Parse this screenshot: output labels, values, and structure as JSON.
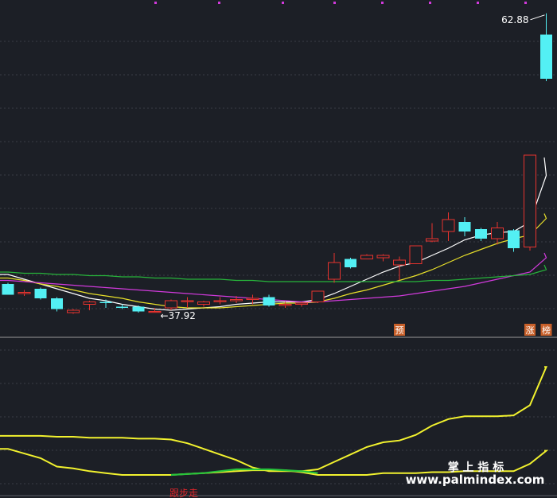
{
  "chart_data": [
    {
      "type": "candlestick",
      "title": "",
      "ylim": [
        36,
        64
      ],
      "candles": [
        {
          "o": 40.2,
          "h": 40.3,
          "l": 39.3,
          "c": 39.3
        },
        {
          "o": 39.4,
          "h": 39.7,
          "l": 39.2,
          "c": 39.5
        },
        {
          "o": 39.8,
          "h": 39.9,
          "l": 38.9,
          "c": 39.0
        },
        {
          "o": 39.0,
          "h": 39.1,
          "l": 37.9,
          "c": 38.1
        },
        {
          "o": 37.8,
          "h": 38.1,
          "l": 37.7,
          "c": 38.0
        },
        {
          "o": 38.5,
          "h": 38.8,
          "l": 38.0,
          "c": 38.7
        },
        {
          "o": 38.7,
          "h": 38.9,
          "l": 38.2,
          "c": 38.6
        },
        {
          "o": 38.3,
          "h": 38.5,
          "l": 38.1,
          "c": 38.2
        },
        {
          "o": 38.3,
          "h": 38.4,
          "l": 37.8,
          "c": 37.9
        },
        {
          "o": 37.9,
          "h": 38.2,
          "l": 37.8,
          "c": 37.9
        },
        {
          "o": 38.2,
          "h": 38.9,
          "l": 38.0,
          "c": 38.8
        },
        {
          "o": 38.8,
          "h": 39.1,
          "l": 38.2,
          "c": 38.8
        },
        {
          "o": 38.5,
          "h": 38.8,
          "l": 38.3,
          "c": 38.7
        },
        {
          "o": 38.8,
          "h": 39.1,
          "l": 38.5,
          "c": 38.8
        },
        {
          "o": 38.8,
          "h": 39.2,
          "l": 38.6,
          "c": 38.9
        },
        {
          "o": 38.9,
          "h": 39.3,
          "l": 38.5,
          "c": 39.0
        },
        {
          "o": 39.1,
          "h": 39.3,
          "l": 38.3,
          "c": 38.4
        },
        {
          "o": 38.4,
          "h": 38.7,
          "l": 38.2,
          "c": 38.5
        },
        {
          "o": 38.5,
          "h": 38.7,
          "l": 38.3,
          "c": 38.6
        },
        {
          "o": 38.7,
          "h": 39.6,
          "l": 38.6,
          "c": 39.6
        },
        {
          "o": 40.6,
          "h": 42.8,
          "l": 40.3,
          "c": 42.0
        },
        {
          "o": 42.3,
          "h": 42.4,
          "l": 41.5,
          "c": 41.6
        },
        {
          "o": 42.3,
          "h": 42.7,
          "l": 42.3,
          "c": 42.6
        },
        {
          "o": 42.4,
          "h": 42.7,
          "l": 42.1,
          "c": 42.6
        },
        {
          "o": 41.8,
          "h": 42.5,
          "l": 40.5,
          "c": 42.2
        },
        {
          "o": 41.9,
          "h": 43.4,
          "l": 41.9,
          "c": 43.4
        },
        {
          "o": 43.8,
          "h": 45.3,
          "l": 43.7,
          "c": 44.0
        },
        {
          "o": 44.6,
          "h": 46.2,
          "l": 43.8,
          "c": 45.6
        },
        {
          "o": 45.4,
          "h": 45.8,
          "l": 44.2,
          "c": 44.6
        },
        {
          "o": 44.8,
          "h": 44.9,
          "l": 43.8,
          "c": 44.0
        },
        {
          "o": 44.0,
          "h": 45.4,
          "l": 43.5,
          "c": 44.9
        },
        {
          "o": 44.7,
          "h": 44.8,
          "l": 42.9,
          "c": 43.2
        },
        {
          "o": 43.3,
          "h": 51.0,
          "l": 43.0,
          "c": 51.0
        },
        {
          "o": 61.1,
          "h": 62.88,
          "l": 57.2,
          "c": 57.4
        }
      ],
      "moving_averages": [
        {
          "color": "#ffffff",
          "values": [
            41.0,
            40.6,
            40.2,
            39.8,
            39.4,
            39.0,
            38.8,
            38.5,
            38.3,
            38.1,
            38.0,
            38.1,
            38.2,
            38.3,
            38.5,
            38.6,
            38.7,
            38.7,
            38.7,
            38.9,
            39.4,
            40.0,
            40.6,
            41.2,
            41.7,
            42.0,
            42.6,
            43.2,
            43.9,
            44.3,
            44.5,
            44.6,
            45.4,
            49.3
          ]
        },
        {
          "color": "#e8e02a",
          "values": [
            40.7,
            40.5,
            40.2,
            40.0,
            39.7,
            39.4,
            39.2,
            39.0,
            38.7,
            38.5,
            38.3,
            38.2,
            38.2,
            38.2,
            38.3,
            38.4,
            38.5,
            38.6,
            38.6,
            38.7,
            39.0,
            39.4,
            39.7,
            40.1,
            40.5,
            40.9,
            41.4,
            42.0,
            42.6,
            43.1,
            43.6,
            44.0,
            44.3,
            45.7
          ]
        },
        {
          "color": "#d13adc",
          "values": [
            40.5,
            40.4,
            40.3,
            40.2,
            40.1,
            40.0,
            39.9,
            39.8,
            39.7,
            39.6,
            39.5,
            39.4,
            39.3,
            39.2,
            39.1,
            39.0,
            38.9,
            38.8,
            38.7,
            38.7,
            38.8,
            38.9,
            39.0,
            39.1,
            39.2,
            39.4,
            39.6,
            39.8,
            40.0,
            40.3,
            40.6,
            40.9,
            41.2,
            42.4
          ]
        },
        {
          "color": "#27b43b",
          "values": [
            41.2,
            41.1,
            41.1,
            41.0,
            41.0,
            40.9,
            40.9,
            40.8,
            40.8,
            40.7,
            40.7,
            40.6,
            40.6,
            40.6,
            40.5,
            40.5,
            40.4,
            40.4,
            40.4,
            40.4,
            40.4,
            40.4,
            40.4,
            40.4,
            40.4,
            40.4,
            40.5,
            40.5,
            40.6,
            40.7,
            40.8,
            40.9,
            41.0,
            41.4
          ]
        }
      ],
      "annotations": {
        "high_label": "62.88",
        "low_label": "37.92",
        "low_index": 9,
        "markers": [
          {
            "text": "预",
            "index": 24
          },
          {
            "text": "涨",
            "index": 32
          },
          {
            "text": "榜",
            "index": 33
          }
        ]
      }
    },
    {
      "type": "line",
      "title": "",
      "ylim": [
        0,
        100
      ],
      "series": [
        {
          "color": "#f2f22e",
          "values": [
            42,
            42,
            42,
            41,
            41,
            40,
            40,
            40,
            39,
            39,
            38,
            34,
            28,
            22,
            16,
            8,
            4,
            4,
            4,
            6,
            14,
            22,
            30,
            35,
            37,
            43,
            53,
            60,
            63,
            63,
            63,
            64,
            75,
            116
          ]
        },
        {
          "color": "#f2f22e",
          "values": [
            28,
            23,
            18,
            9,
            7,
            4,
            2,
            0,
            0,
            0,
            0,
            1,
            2,
            3,
            4,
            5,
            5,
            5,
            3,
            0,
            0,
            0,
            0,
            2,
            2,
            2,
            3,
            3,
            4,
            4,
            4,
            4,
            12,
            26
          ]
        },
        {
          "color": "#27c43b",
          "values": [
            null,
            null,
            null,
            null,
            null,
            null,
            null,
            null,
            null,
            null,
            0,
            1,
            2,
            4,
            6,
            6,
            6,
            5,
            4,
            2,
            null,
            null,
            null,
            null,
            null,
            null,
            null,
            null,
            null,
            null,
            null,
            null,
            null,
            null
          ]
        }
      ],
      "annotations": {
        "bottom_label": "跟步走"
      }
    }
  ],
  "watermark": {
    "line1": "掌 上 指 标",
    "line2": "www.palmindex.com"
  }
}
